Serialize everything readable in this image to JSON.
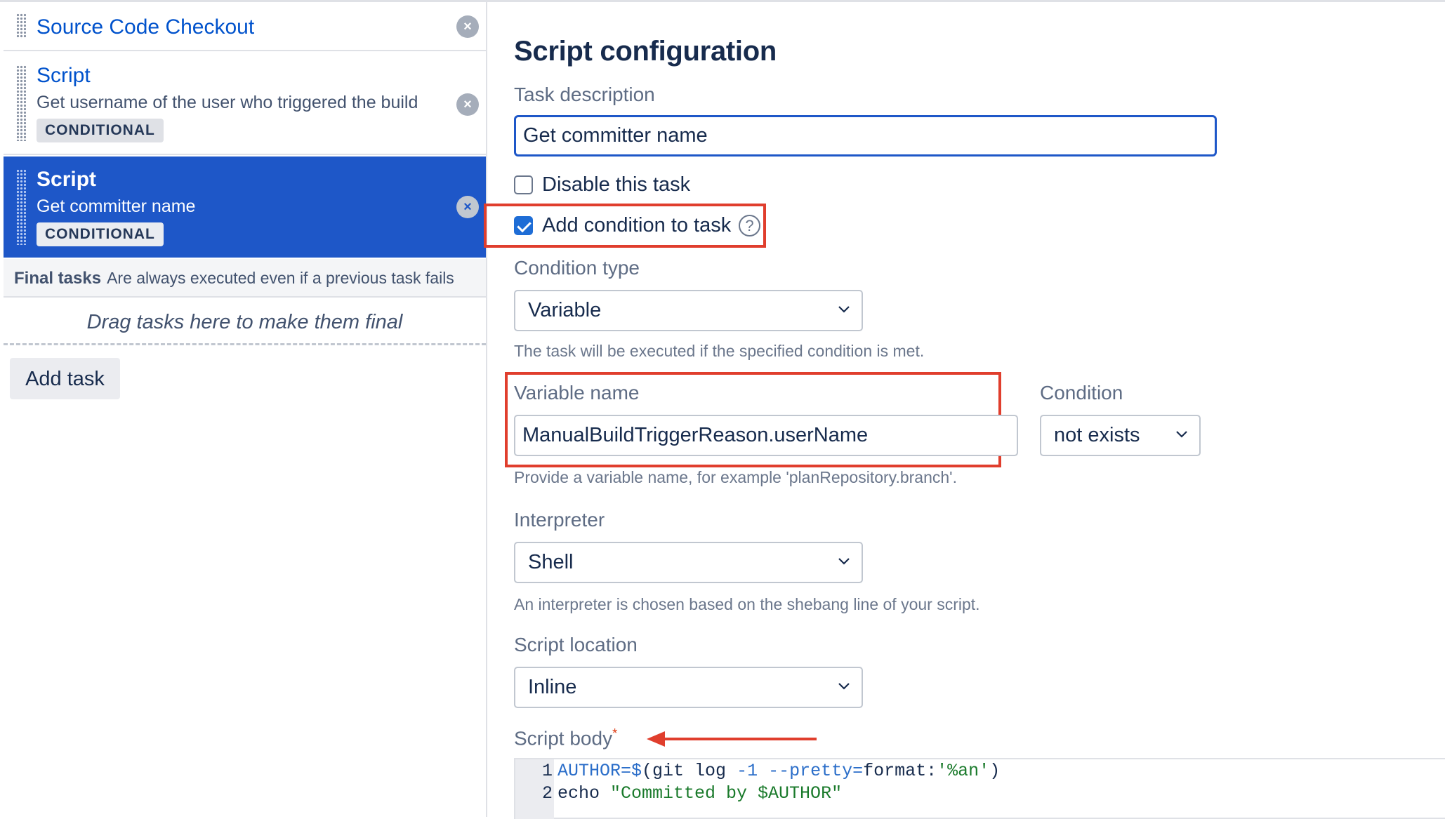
{
  "tasks": [
    {
      "title": "Source Code Checkout",
      "description": "",
      "badge": ""
    },
    {
      "title": "Script",
      "description": "Get username of the user who triggered the build",
      "badge": "CONDITIONAL"
    },
    {
      "title": "Script",
      "description": "Get committer name",
      "badge": "CONDITIONAL",
      "selected": true
    }
  ],
  "remove_icon": "×",
  "final_tasks": {
    "title": "Final tasks",
    "description": "Are always executed even if a previous task fails",
    "drop_hint": "Drag tasks here to make them final"
  },
  "add_task_label": "Add task",
  "form": {
    "title": "Script configuration",
    "task_description": {
      "label": "Task description",
      "value": "Get committer name"
    },
    "disable_task": {
      "label": "Disable this task",
      "checked": false
    },
    "add_condition": {
      "label": "Add condition to task",
      "checked": true,
      "help_icon": "?"
    },
    "condition_type": {
      "label": "Condition type",
      "value": "Variable",
      "help": "The task will be executed if the specified condition is met."
    },
    "variable_name": {
      "label": "Variable name",
      "value": "ManualBuildTriggerReason.userName",
      "help": "Provide a variable name, for example 'planRepository.branch'."
    },
    "condition": {
      "label": "Condition",
      "value": "not exists"
    },
    "interpreter": {
      "label": "Interpreter",
      "value": "Shell",
      "help": "An interpreter is chosen based on the shebang line of your script."
    },
    "script_location": {
      "label": "Script location",
      "value": "Inline"
    },
    "script_body": {
      "label": "Script body",
      "required_marker": "*",
      "lines": [
        {
          "num": "1",
          "var": "AUTHOR",
          "eq": "=$",
          "open": "(git log ",
          "flag": "-1",
          "sp": " ",
          "opt": "--pretty",
          "eq2": "=",
          "fmt": "format:",
          "str": "'%an'",
          "close": ")"
        },
        {
          "num": "2",
          "cmd": "echo ",
          "str": "\"Committed by $AUTHOR\""
        }
      ]
    }
  },
  "colors": {
    "accent": "#1e57c8",
    "highlight": "#e03e2d"
  }
}
